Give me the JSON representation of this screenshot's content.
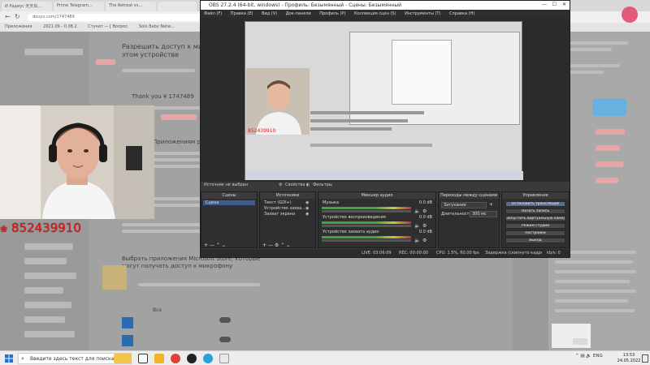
{
  "browser": {
    "tabs": [
      "И Радиус 天天出...",
      "Prime Telegram...",
      "The Retreat vs...",
      "",
      "",
      "",
      "",
      ""
    ],
    "address": "douyu.com/1747489",
    "bookmarks": [
      "Приложения",
      "",
      "2021.09 - 0.08.2",
      "Стучит — [ Вопрос",
      "",
      "Solo Baby Netw..."
    ],
    "page": {
      "heading": "Разрешить доступ к микрофону на этом устройстве",
      "thanks": "Thank you ¥ 1747489",
      "notice": "Приложениям разрешен доступ к микрофону",
      "store_notice": "Выбрать приложения Microsoft Store, которые могут получать доступ к микрофону",
      "allow_label": "Все"
    }
  },
  "obs": {
    "title": "OBS 27.2.4 (64-bit, windows) - Профиль: Безымянный - Сцены: Безымянный",
    "menu": [
      "Файл (F)",
      "Правка (E)",
      "Вид (V)",
      "Док-панели",
      "Профиль (P)",
      "Коллекция сцен (S)",
      "Инструменты (T)",
      "Справка (H)"
    ],
    "source_bar": "Источник не выбран",
    "source_props": "Свойства",
    "source_filters": "Фильтры",
    "panels": {
      "scenes": {
        "title": "Сцены",
        "items": [
          "Сцена"
        ]
      },
      "sources": {
        "title": "Источники",
        "items": [
          "Текст (GDI+)",
          "Устройство захва...",
          "Захват экрана"
        ]
      },
      "mixer": {
        "title": "Микшер аудио",
        "channels": [
          {
            "name": "Музыка",
            "db": "0.0 dB"
          },
          {
            "name": "Устройство воспроизведения",
            "db": "0.0 dB"
          },
          {
            "name": "Устройство захвата аудио",
            "db": "0.0 dB"
          }
        ]
      },
      "transitions": {
        "title": "Переходы между сценами",
        "type": "Затухание",
        "duration_label": "Длительность",
        "duration": "300 мс"
      },
      "controls": {
        "title": "Управление",
        "buttons": [
          "Остановить трансляцию",
          "Начать запись",
          "Запустить виртуальную камеру",
          "Режим студии",
          "Настройки",
          "Выход"
        ]
      }
    },
    "status": {
      "live": "LIVE: 03:06:09",
      "rec": "REC: 00:00:00",
      "cpu": "CPU: 1.5%, 60.00 fps",
      "frames": "Задержка (скипнуто кадров 1%)",
      "kbps": "kb/s: 0"
    }
  },
  "overlay": {
    "counter": "852439910"
  },
  "taskbar": {
    "search_placeholder": "Введите здесь текст для поиска",
    "lang": "ENG",
    "time": "13:53",
    "date": "24.05.2022"
  },
  "colors": {
    "accent_red": "#e2161b",
    "obs_bg": "#2f2f2f",
    "obs_select": "#3f5b8d",
    "pink_button": "#e9a5a5"
  }
}
